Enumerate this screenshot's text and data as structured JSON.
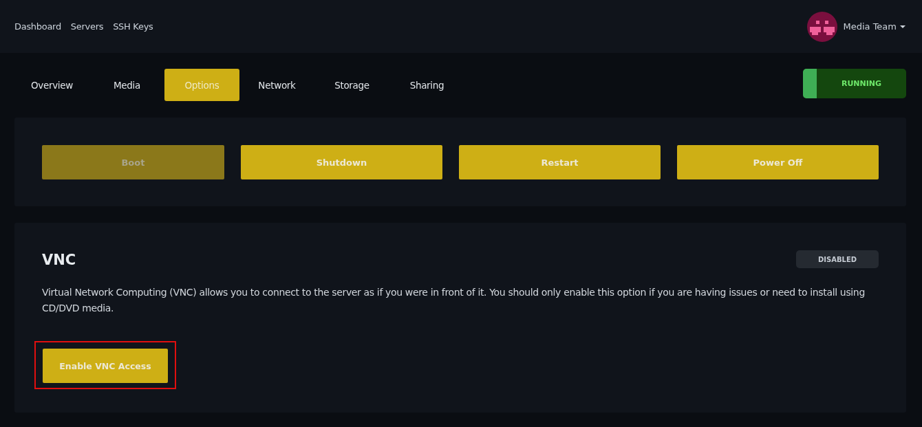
{
  "nav": {
    "links": [
      {
        "label": "Dashboard"
      },
      {
        "label": "Servers"
      },
      {
        "label": "SSH Keys"
      }
    ],
    "account": {
      "name": "Media Team"
    }
  },
  "tabs": [
    {
      "label": "Overview",
      "selected": false
    },
    {
      "label": "Media",
      "selected": false
    },
    {
      "label": "Options",
      "selected": true
    },
    {
      "label": "Network",
      "selected": false
    },
    {
      "label": "Storage",
      "selected": false
    },
    {
      "label": "Sharing",
      "selected": false
    }
  ],
  "server_status": {
    "label": "RUNNING",
    "kind": "running"
  },
  "power_actions": [
    {
      "label": "Boot",
      "disabled": true
    },
    {
      "label": "Shutdown",
      "disabled": false
    },
    {
      "label": "Restart",
      "disabled": false
    },
    {
      "label": "Power Off",
      "disabled": false
    }
  ],
  "vnc": {
    "title": "VNC",
    "status": "DISABLED",
    "description": "Virtual Network Computing (VNC) allows you to connect to the server as if you were in front of it. You should only enable this option if you are having issues or need to install using CD/DVD media.",
    "button": {
      "label": "Enable VNC Access",
      "highlighted": true
    }
  }
}
